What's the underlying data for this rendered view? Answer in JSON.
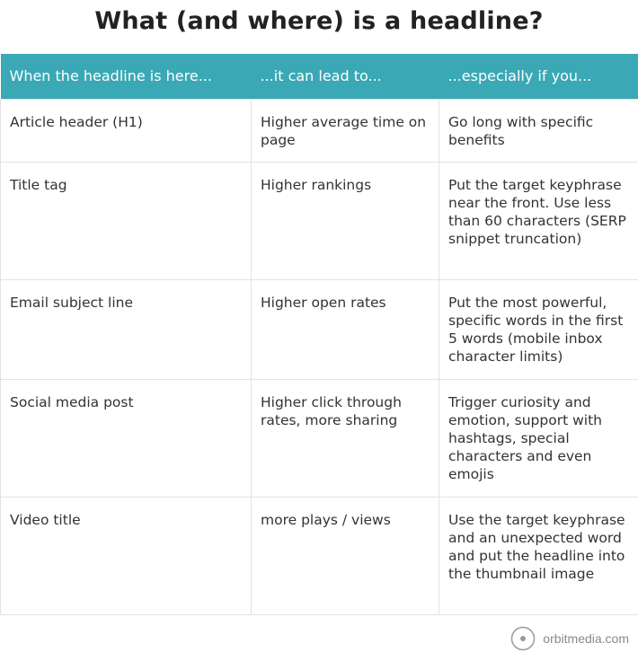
{
  "title": "What (and where) is a headline?",
  "table": {
    "headers": [
      "When the headline is here...",
      "...it can lead to...",
      "...especially if you..."
    ],
    "rows": [
      [
        "Article header (H1)",
        "Higher average time on page",
        "Go long with specific benefits"
      ],
      [
        "Title tag",
        "Higher rankings",
        "Put the target keyphrase near the front. Use less than 60 characters (SERP snippet truncation)"
      ],
      [
        "Email subject line",
        "Higher open rates",
        "Put the most powerful, specific words in the first 5 words (mobile inbox character limits)"
      ],
      [
        "Social media post",
        "Higher click through rates, more sharing",
        "Trigger curiosity and emotion, support with hashtags, special characters and even emojis"
      ],
      [
        "Video title",
        "more plays / views",
        "Use the target keyphrase and an unexpected word and put the headline into the thumbnail image"
      ]
    ]
  },
  "brand": {
    "text": "orbitmedia.com",
    "icon": "orbit-logo-icon"
  },
  "colors": {
    "header_bg": "#3aa8b5",
    "header_text": "#ffffff",
    "border": "#e3e3e3",
    "body_text": "#333333"
  }
}
